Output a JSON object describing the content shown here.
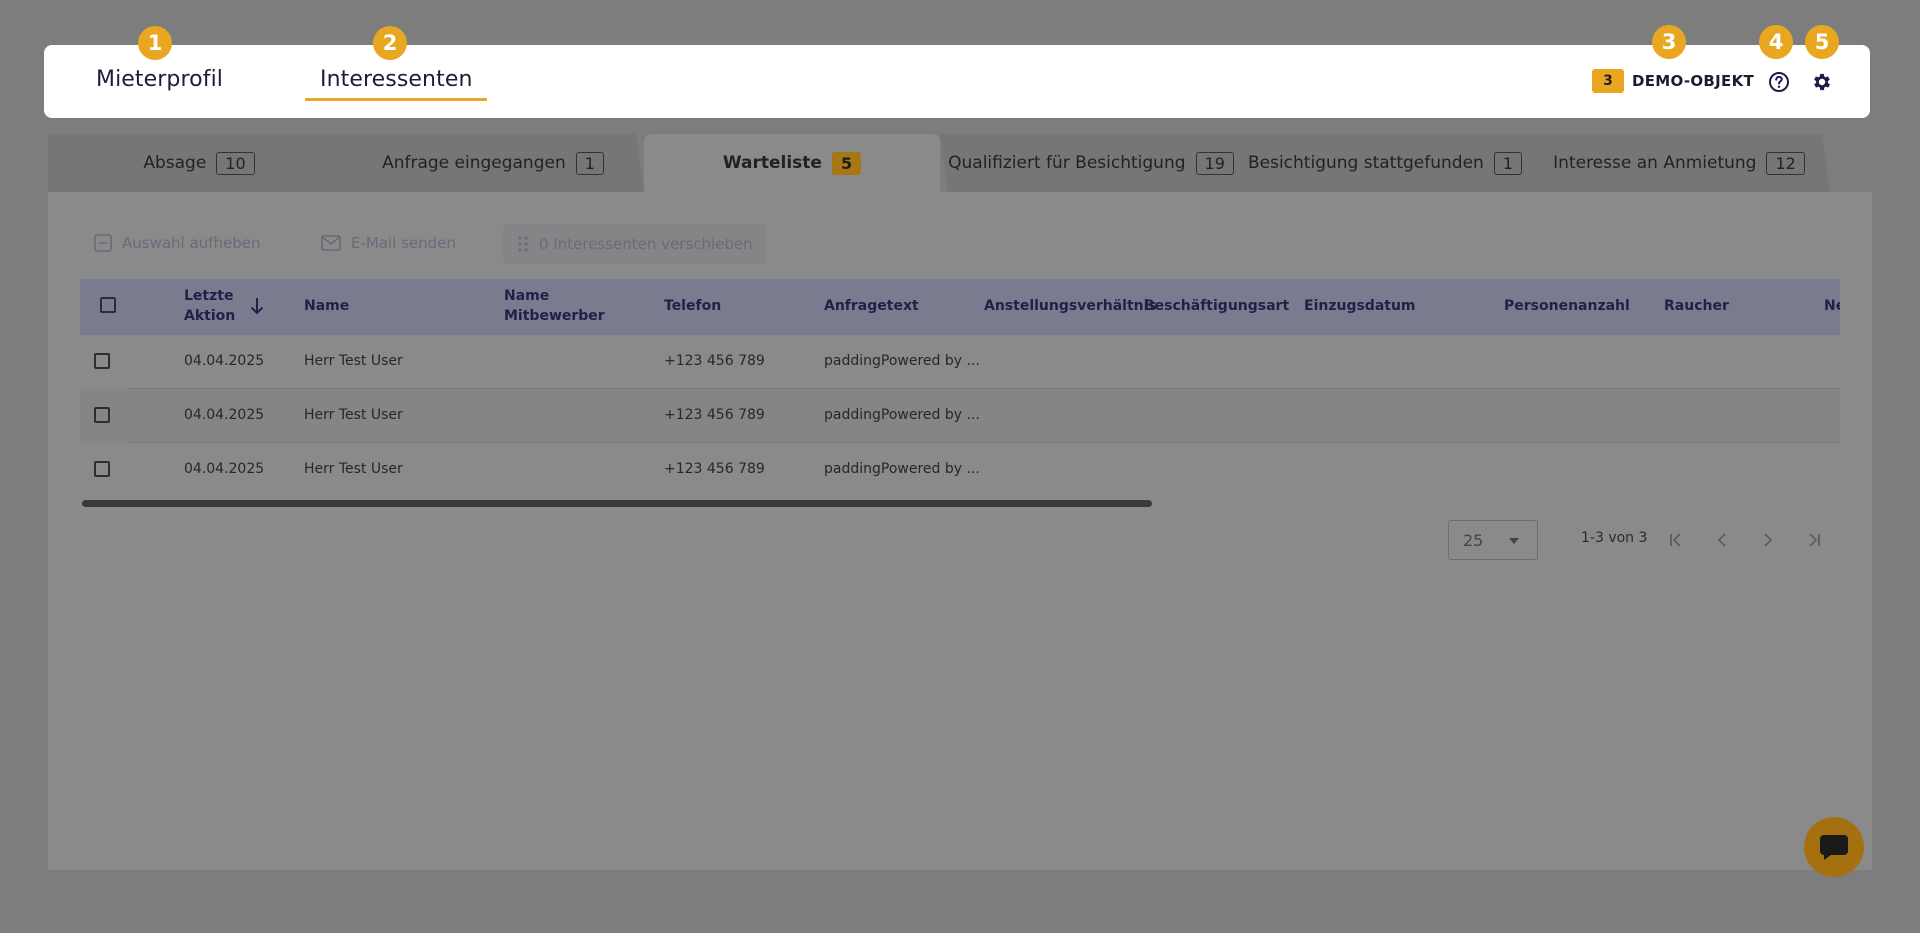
{
  "header": {
    "tabs": [
      {
        "label": "Mieterprofil",
        "marker": "1"
      },
      {
        "label": "Interessenten",
        "marker": "2",
        "active": true
      }
    ],
    "object": {
      "count": "3",
      "name": "DEMO-OBJEKT",
      "marker": "3"
    },
    "help_marker": "4",
    "settings_marker": "5",
    "icons": {
      "help": "question-circle-icon",
      "settings": "gear-icon"
    },
    "accent_color": "#e9a621"
  },
  "status_tabs": [
    {
      "label": "Absage",
      "count": "10"
    },
    {
      "label": "Anfrage eingegangen",
      "count": "1"
    },
    {
      "label": "Warteliste",
      "count": "5",
      "active": true
    },
    {
      "label": "Qualifiziert für Besichtigung",
      "count": "19"
    },
    {
      "label": "Besichtigung stattgefunden",
      "count": "1"
    },
    {
      "label": "Interesse an Anmietung",
      "count": "12"
    }
  ],
  "toolbar": {
    "deselect": "Auswahl aufheben",
    "email": "E-Mail senden",
    "move": "0 Interessenten verschieben"
  },
  "table": {
    "columns": {
      "last_action_1": "Letzte",
      "last_action_2": "Aktion",
      "name": "Name",
      "competitor_1": "Name",
      "competitor_2": "Mitbewerber",
      "phone": "Telefon",
      "request_text": "Anfragetext",
      "employment": "Anstellungsverhältnis",
      "employment_type": "Beschäftigungsart",
      "move_in": "Einzugsdatum",
      "persons": "Personenanzahl",
      "smoker": "Raucher",
      "cut": "Ne"
    },
    "sort": "descending",
    "rows": [
      {
        "date": "04.04.2025",
        "name": "Herr Test User",
        "competitor": "",
        "phone": "+123 456 789",
        "request_text": "paddingPowered by ..."
      },
      {
        "date": "04.04.2025",
        "name": "Herr Test User",
        "competitor": "",
        "phone": "+123 456 789",
        "request_text": "paddingPowered by ..."
      },
      {
        "date": "04.04.2025",
        "name": "Herr Test User",
        "competitor": "",
        "phone": "+123 456 789",
        "request_text": "paddingPowered by ..."
      }
    ]
  },
  "pagination": {
    "page_size": "25",
    "range": "1-3 von 3"
  }
}
